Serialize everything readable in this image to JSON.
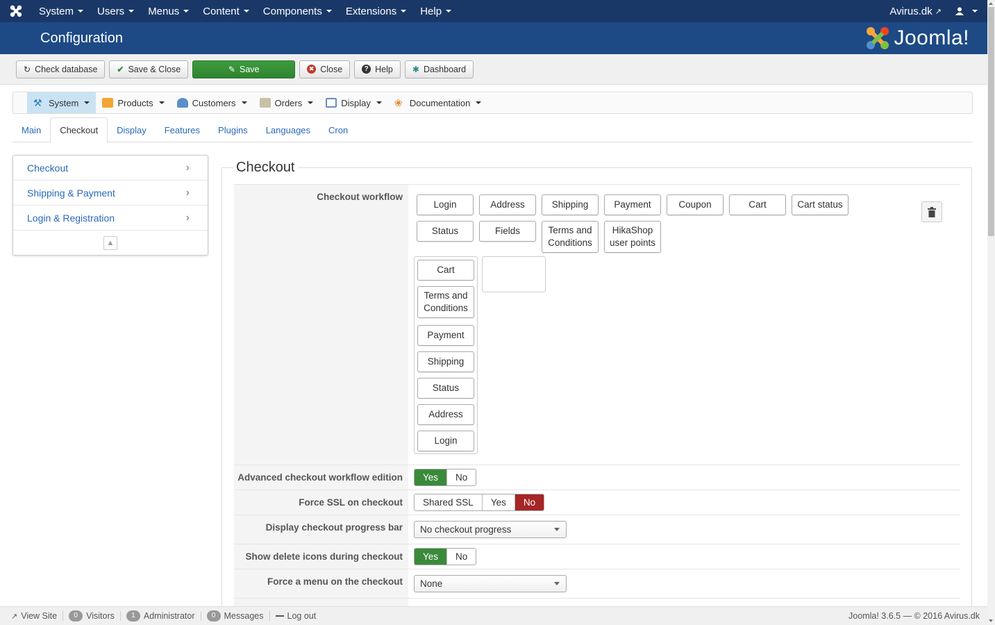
{
  "navbar": {
    "items": [
      "System",
      "Users",
      "Menus",
      "Content",
      "Components",
      "Extensions",
      "Help"
    ],
    "site_link": "Avirus.dk"
  },
  "header": {
    "title": "Configuration",
    "logo_text": "Joomla!"
  },
  "toolbar": {
    "check_database": "Check database",
    "save_close": "Save & Close",
    "save": "Save",
    "close": "Close",
    "help": "Help",
    "dashboard": "Dashboard"
  },
  "hika_menu": {
    "items": [
      "System",
      "Products",
      "Customers",
      "Orders",
      "Display",
      "Documentation"
    ]
  },
  "tabs": [
    "Main",
    "Checkout",
    "Display",
    "Features",
    "Plugins",
    "Languages",
    "Cron"
  ],
  "side_nav": [
    "Checkout",
    "Shipping & Payment",
    "Login & Registration"
  ],
  "section": {
    "title": "Checkout",
    "workflow": {
      "label": "Checkout workflow",
      "available_row1": [
        "Login",
        "Address",
        "Shipping",
        "Payment",
        "Coupon",
        "Cart",
        "Cart status"
      ],
      "available_row2": [
        "Status",
        "Fields",
        "Terms and Conditions",
        "HikaShop user points"
      ],
      "step1": [
        "Cart",
        "Terms and Conditions",
        "Payment",
        "Shipping",
        "Status",
        "Address",
        "Login"
      ]
    },
    "advanced": {
      "label": "Advanced checkout workflow edition",
      "options": [
        "Yes",
        "No"
      ],
      "selected": "Yes"
    },
    "force_ssl": {
      "label": "Force SSL on checkout",
      "options": [
        "Shared SSL",
        "Yes",
        "No"
      ],
      "selected": "No"
    },
    "progress_bar": {
      "label": "Display checkout progress bar",
      "value": "No checkout progress"
    },
    "delete_icons": {
      "label": "Show delete icons during checkout",
      "options": [
        "Yes",
        "No"
      ],
      "selected": "Yes"
    },
    "force_menu": {
      "label": "Force a menu on the checkout",
      "value": "None"
    }
  },
  "statusbar": {
    "view_site": "View Site",
    "visitors_count": "0",
    "visitors": "Visitors",
    "admin_count": "1",
    "administrator": "Administrator",
    "messages_count": "0",
    "messages": "Messages",
    "logout": "Log out",
    "version": "Joomla! 3.6.5 — © 2016 Avirus.dk"
  },
  "colors": {
    "navbar": "#1a3867",
    "header": "#1d4a85",
    "save_green": "#3a8a3a",
    "no_red": "#a62525",
    "link_blue": "#2a69b8"
  }
}
